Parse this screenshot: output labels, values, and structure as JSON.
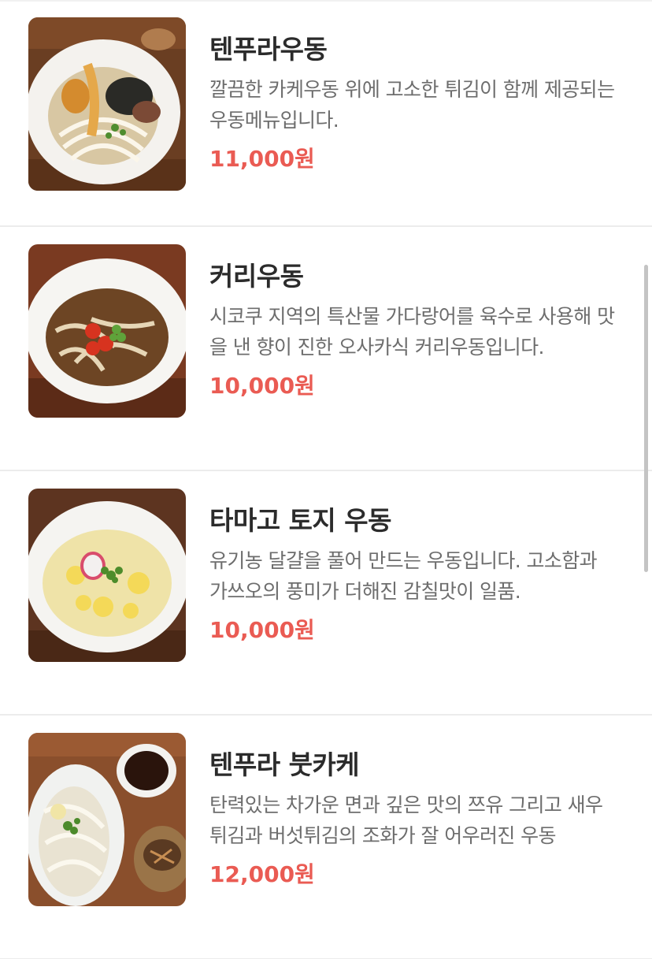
{
  "menu": {
    "items": [
      {
        "name": "텐푸라우동",
        "description": "깔끔한 카케우동 위에 고소한 튀김이 함께 제공되는 우동메뉴입니다.",
        "price": "11,000원",
        "image_icon": "tempura-udon-image"
      },
      {
        "name": "커리우동",
        "description": "시코쿠 지역의 특산물 가다랑어를 육수로 사용해 맛을 낸 향이 진한 오사카식 커리우동입니다.",
        "price": "10,000원",
        "image_icon": "curry-udon-image"
      },
      {
        "name": "타마고 토지 우동",
        "description": "유기농 달걀을 풀어 만드는 우동입니다. 고소함과 가쓰오의 풍미가 더해진 감칠맛이 일품.",
        "price": "10,000원",
        "image_icon": "tamago-toji-udon-image"
      },
      {
        "name": "텐푸라 붓카케",
        "description": "탄력있는 차가운 면과 깊은 맛의 쯔유 그리고 새우튀김과 버섯튀김의 조화가 잘 어우러진 우동",
        "price": "12,000원",
        "image_icon": "tempura-bukkake-image"
      }
    ]
  },
  "colors": {
    "price": "#ea5b53",
    "title": "#2b2b2b",
    "description": "#6d6d6d",
    "divider": "#ececec"
  }
}
